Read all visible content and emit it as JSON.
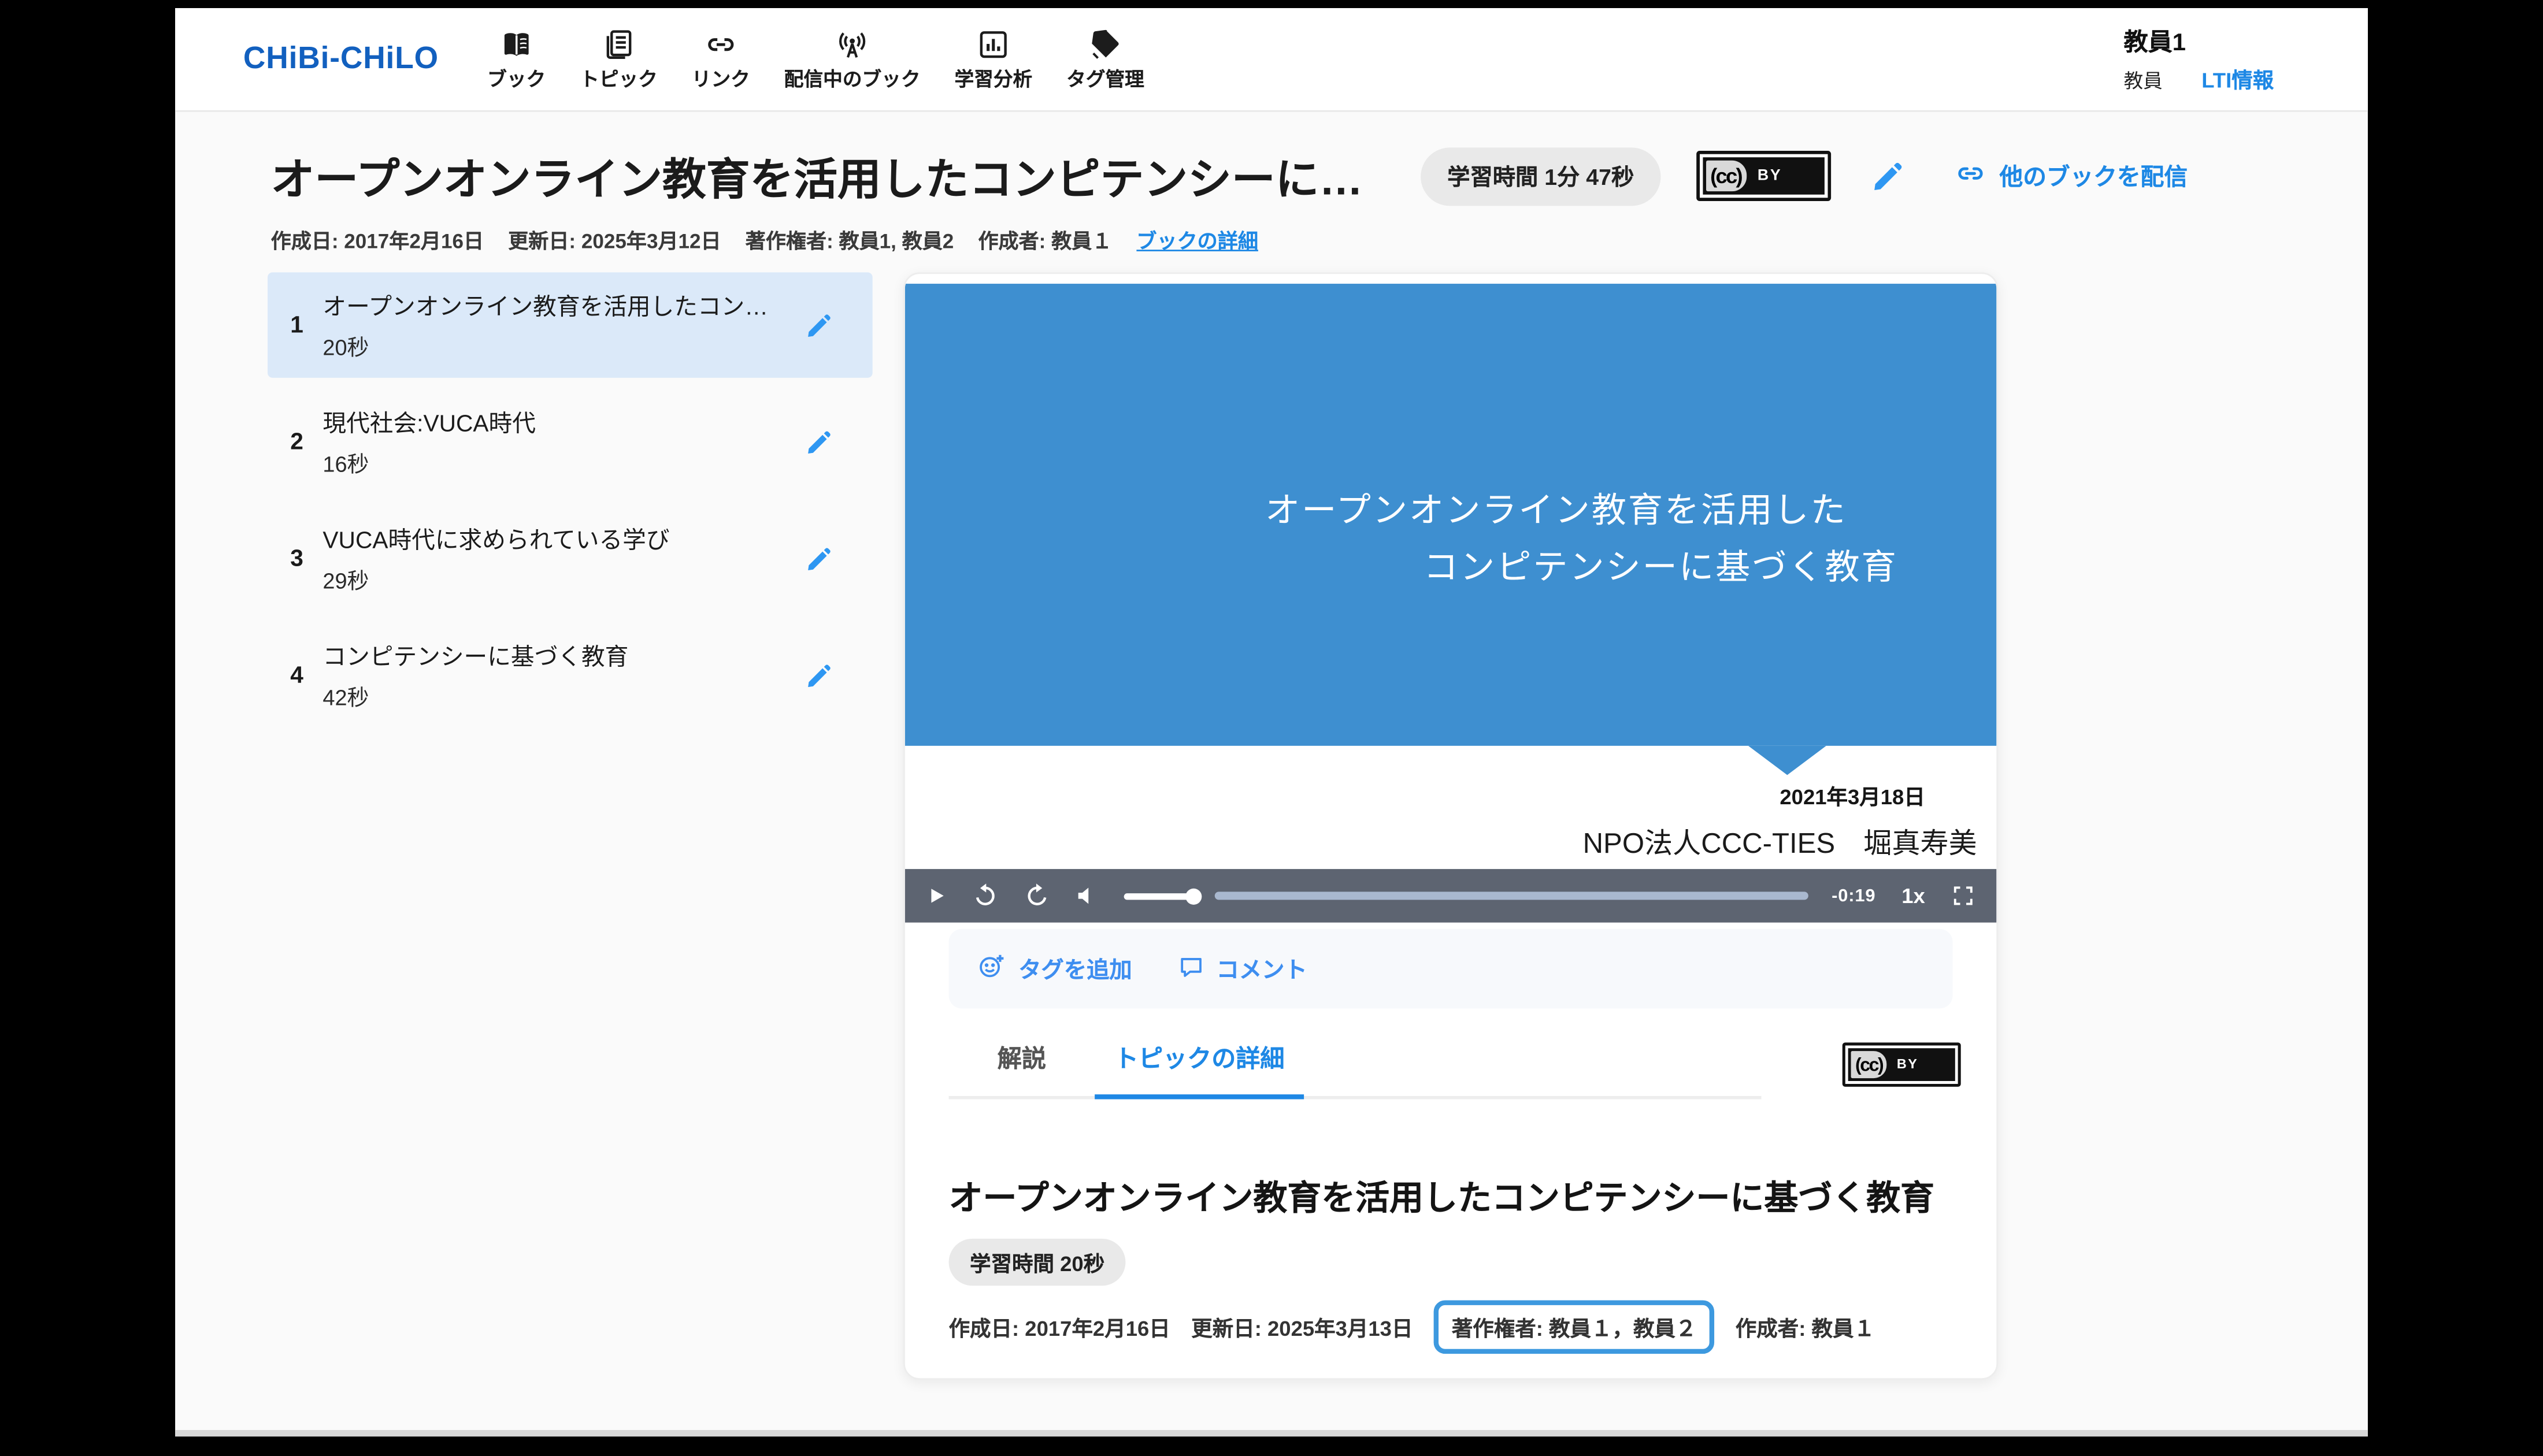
{
  "colors": {
    "accent": "#1e88e5",
    "brand_blue": "#1260bf",
    "slide_blue": "#3e8fd0",
    "highlight_border": "#3d99df",
    "selected_topic_bg": "#dbe9f9"
  },
  "navbar": {
    "brand": "CHiBi-CHiLO",
    "items": [
      {
        "label": "ブック",
        "icon": "book-icon"
      },
      {
        "label": "トピック",
        "icon": "topic-icon"
      },
      {
        "label": "リンク",
        "icon": "link-icon"
      },
      {
        "label": "配信中のブック",
        "icon": "broadcast-icon"
      },
      {
        "label": "学習分析",
        "icon": "analytics-icon"
      },
      {
        "label": "タグ管理",
        "icon": "tag-icon"
      }
    ],
    "user": {
      "name": "教員1",
      "role": "教員",
      "lti_link": "LTI情報"
    }
  },
  "book": {
    "title": "オープンオンライン教育を活用したコンピテンシーに…",
    "learning_time": "学習時間 1分 47秒",
    "license": {
      "icon": "(cc)",
      "label": "BY"
    },
    "distribute_link": "他のブックを配信",
    "created": "作成日: 2017年2月16日",
    "updated": "更新日: 2025年3月12日",
    "copyright": "著作権者: 教員1, 教員2",
    "author": "作成者: 教員１",
    "details_link": "ブックの詳細"
  },
  "topics": [
    {
      "no": "1",
      "title": "オープンオンライン教育を活用したコン…",
      "duration": "20秒"
    },
    {
      "no": "2",
      "title": "現代社会:VUCA時代",
      "duration": "16秒"
    },
    {
      "no": "3",
      "title": "VUCA時代に求められている学び",
      "duration": "29秒"
    },
    {
      "no": "4",
      "title": "コンピテンシーに基づく教育",
      "duration": "42秒"
    }
  ],
  "player": {
    "slide": {
      "line1": "オープンオンライン教育を活用した",
      "line2": "コンピテンシーに基づく教育",
      "date": "2021年3月18日",
      "credit": "NPO法人CCC-TIES　堀真寿美"
    },
    "controls": {
      "remaining": "-0:19",
      "speed": "1x"
    }
  },
  "topic_panel": {
    "add_tag": "タグを追加",
    "comment": "コメント",
    "tabs": [
      {
        "label": "解説"
      },
      {
        "label": "トピックの詳細"
      }
    ],
    "license": {
      "icon": "(cc)",
      "label": "BY"
    },
    "heading": "オープンオンライン教育を活用したコンピテンシーに基づく教育",
    "learning_time": "学習時間 20秒",
    "created": "作成日: 2017年2月16日",
    "updated": "更新日: 2025年3月13日",
    "copyright": "著作権者: 教員１，教員２",
    "author": "作成者: 教員１"
  }
}
